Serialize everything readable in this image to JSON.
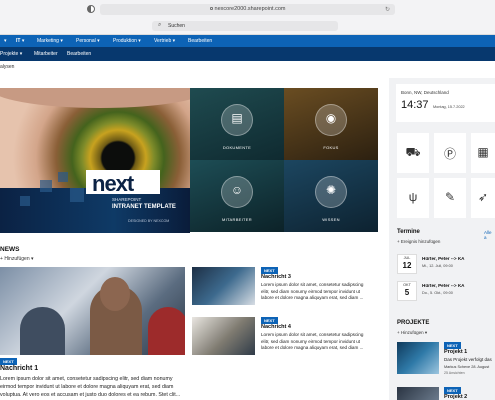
{
  "browser": {
    "url": "nexcore2000.sharepoint.com",
    "search_label": "Suchen"
  },
  "nav_primary": {
    "items": [
      "IT",
      "Marketing",
      "Personal",
      "Produktion",
      "Vertrieb",
      "Bearbeiten"
    ]
  },
  "nav_secondary": {
    "items": [
      "Projekte",
      "Mitarbeiter",
      "Bearbeiten"
    ]
  },
  "breadcrumb": "alysen",
  "hero": {
    "logo_text": "next",
    "line1": "SHAREPOINT",
    "line2": "INTRANET TEMPLATE",
    "line3": "DESIGNED BY NEXCOM"
  },
  "tiles": [
    {
      "label": "DOKUMENTE",
      "icon": "document-search-icon",
      "color": "#163a3f"
    },
    {
      "label": "FOKUS",
      "icon": "eye-icon",
      "color": "#4e3a1c"
    },
    {
      "label": "MITARBEITER",
      "icon": "people-icon",
      "color": "#123a40"
    },
    {
      "label": "WISSEN",
      "icon": "lightbulb-icon",
      "color": "#163446"
    }
  ],
  "news": {
    "heading": "NEWS",
    "add_label": "Hinzufügen",
    "main": {
      "badge": "NEXT",
      "title": "Nachricht 1",
      "body_lines": [
        "Lorem ipsum dolor sit amet, consetetur sadipscing elitr, sed diam nonumy",
        "eirmod tempor invidunt ut labore et dolore magna aliquyam erat, sed diam",
        "voluptua. At vero eos et accusam et justo duo dolores et ea rebum. Stet clit..."
      ]
    },
    "side": [
      {
        "badge": "NEXT",
        "title": "Nachricht 3",
        "body_lines": [
          "Lorem ipsum dolor sit amet, consetetur sadipscing",
          "elitr, sed diam nonumy eirmod tempor invidunt ut",
          "labore et dolore magna aliquyam erat, sed diam ..."
        ]
      },
      {
        "badge": "NEXT",
        "title": "Nachricht 4",
        "body_lines": [
          "Lorem ipsum dolor sit amet, consetetur sadipscing",
          "elitr, sed diam nonumy eirmod tempor invidunt ut",
          "labore et dolore magna aliquyam erat, sed diam ..."
        ]
      }
    ]
  },
  "clock": {
    "location": "Bonn, NW, Deutschland",
    "time": "14:37",
    "date": "Montag, 15.7.2022"
  },
  "quick_actions": [
    {
      "icon": "car-icon"
    },
    {
      "icon": "parking-icon"
    },
    {
      "icon": "calendar-icon"
    },
    {
      "icon": "cutlery-icon"
    },
    {
      "icon": "wrench-icon"
    },
    {
      "icon": "rocket-icon"
    }
  ],
  "termine": {
    "heading": "Termine",
    "all_label": "Alle a",
    "add_label": "Ereignis hinzufügen",
    "events": [
      {
        "day": "12",
        "month": "JUL",
        "title": "Hürter, Peter --> KA",
        "date": "Mi., 12. Juli, 09:00"
      },
      {
        "day": "5",
        "month": "OKT",
        "title": "Hürter, Peter --> KA",
        "date": "Do., 5. Okt., 09:00"
      }
    ]
  },
  "projekte": {
    "heading": "PROJEKTE",
    "add_label": "Hinzufügen",
    "items": [
      {
        "badge": "NEXT",
        "title": "Projekt 1",
        "subtitle": "Das Projekt verfolgt das",
        "author": "Markus Scheve 28. August",
        "views": "25 Ansichten"
      },
      {
        "badge": "NEXT",
        "title": "Projekt 2",
        "subtitle": "",
        "author": "",
        "views": ""
      }
    ]
  }
}
